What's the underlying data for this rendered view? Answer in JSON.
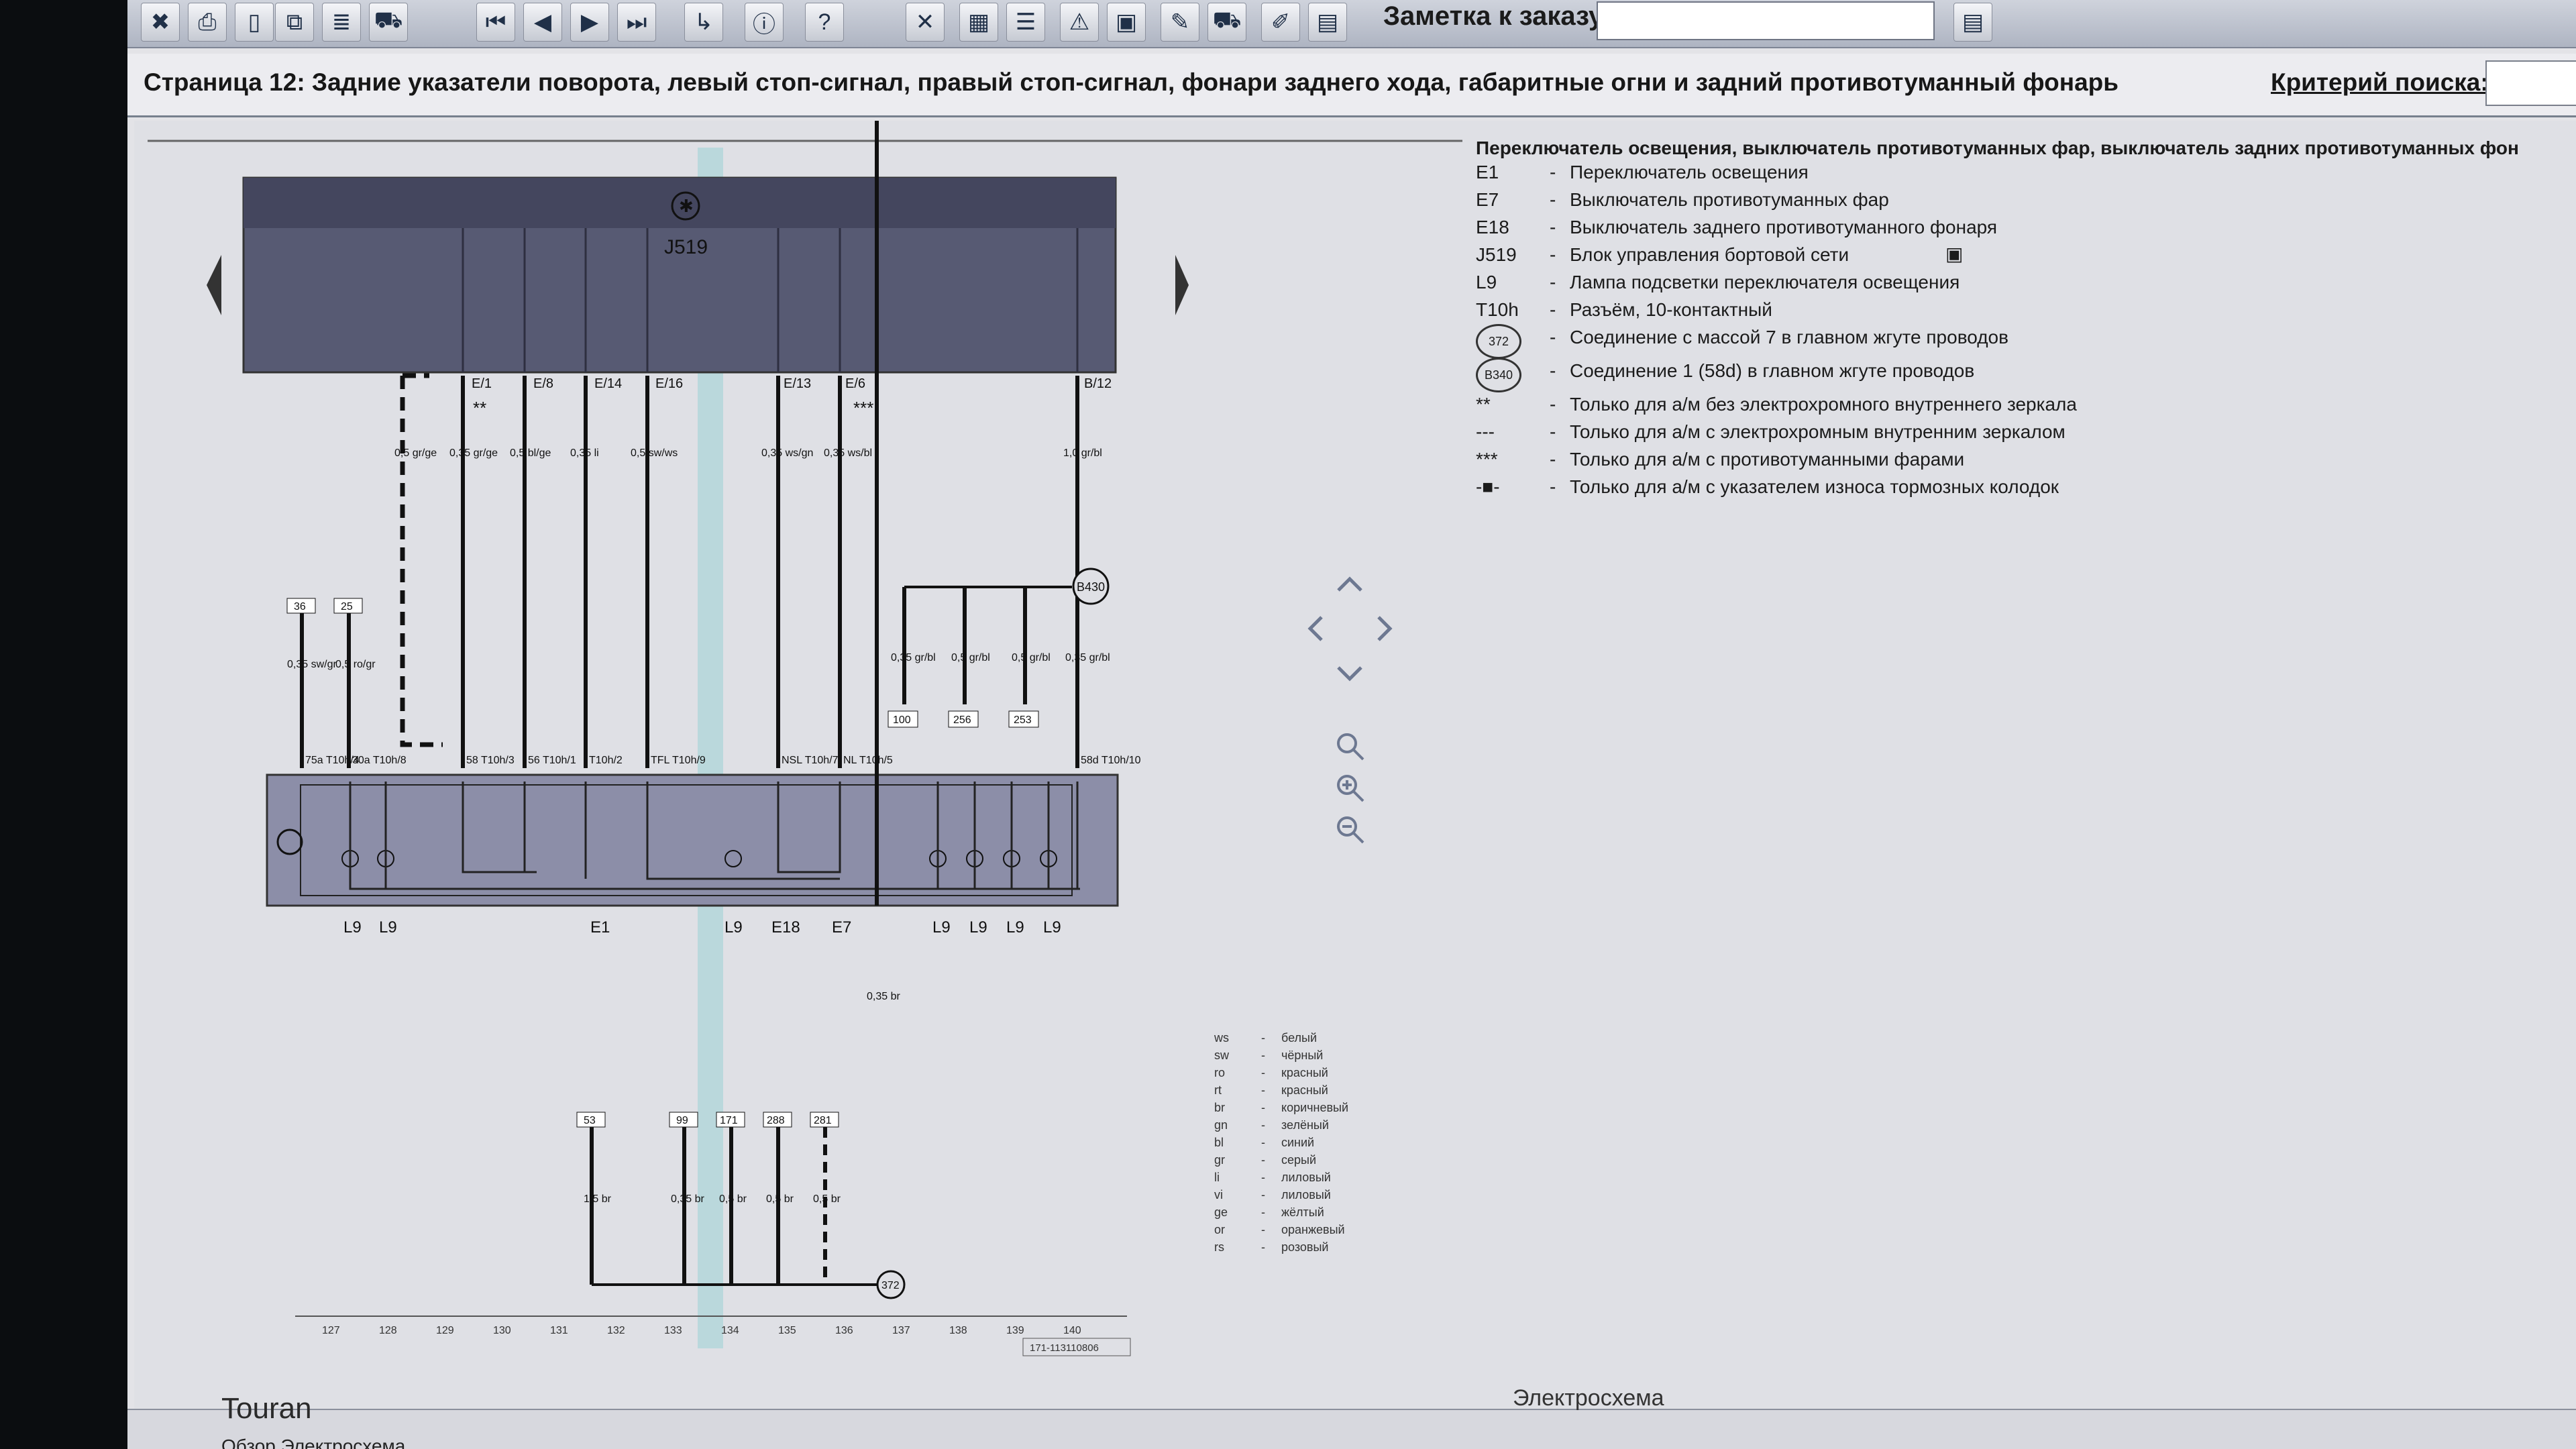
{
  "toolbar": {
    "buttons": [
      "tool-icon",
      "print-icon",
      "document-icon",
      "copy-icon",
      "notes-icon",
      "car-icon",
      "first-icon",
      "prev-icon",
      "next-icon",
      "last-icon",
      "link-icon",
      "info-icon",
      "help-icon",
      "wrench-icon",
      "book-icon",
      "list-icon",
      "warning-icon",
      "save-icon",
      "tools-icon",
      "car2-icon",
      "edit-icon",
      "report-icon"
    ],
    "note_label": "Заметка к заказу:",
    "note_value": ""
  },
  "header": {
    "title": "Страница 12: Задние указатели поворота, левый стоп-сигнал, правый стоп-сигнал, фонари заднего хода, габаритные огни и задний противотуманный фонарь",
    "search_label": "Критерий поиска:",
    "search_value": ""
  },
  "legend": {
    "title": "Переключатель освещения, выключатель противотуманных фар, выключатель задних противотуманных фон",
    "items": [
      {
        "code": "E1",
        "text": "Переключатель освещения"
      },
      {
        "code": "E7",
        "text": "Выключатель противотуманных фар"
      },
      {
        "code": "E18",
        "text": "Выключатель заднего противотуманного фонаря"
      },
      {
        "code": "J519",
        "text": "Блок управления бортовой сети"
      },
      {
        "code": "L9",
        "text": "Лампа подсветки переключателя освещения"
      },
      {
        "code": "T10h",
        "text": "Разъём, 10-контактный"
      },
      {
        "code": "372",
        "text": "Соединение с массой 7 в главном жгуте проводов"
      },
      {
        "code": "B340",
        "text": "Соединение 1 (58d) в главном жгуте проводов"
      },
      {
        "code": "**",
        "text": "Только для а/м без электрохромного внутреннего зеркала"
      },
      {
        "code": "---",
        "text": "Только для а/м с электрохромным внутренним зеркалом"
      },
      {
        "code": "***",
        "text": "Только для а/м с противотуманными фарами"
      },
      {
        "code": "-■-",
        "text": "Только для а/м с указателем износа тормозных колодок"
      }
    ]
  },
  "diagram": {
    "unit_label": "J519",
    "pins_top": [
      "E/1",
      "E/8",
      "E/14",
      "E/16",
      "E/13",
      "E/6",
      "B/12"
    ],
    "wire_specs": [
      "0,5 gr/ge",
      "0,35 gr/ge",
      "0,5 bl/ge",
      "0,35 li",
      "0,5 sw/ws",
      "0,35 ws/gn",
      "0,35 ws/bl",
      "1,0 gr/bl"
    ],
    "connector_labels": [
      "75a T10h/4",
      "30a T10h/8",
      "58 T10h/3",
      "56 T10h/1",
      "T10h/2",
      "TFL T10h/9",
      "NSL T10h/7",
      "NL T10h/5",
      "58d T10h/10"
    ],
    "branch_specs": [
      "0,35 gr/bl",
      "0,5 gr/bl",
      "0,5 gr/bl",
      "0,35 gr/bl"
    ],
    "branch_refs": [
      "100",
      "256",
      "253"
    ],
    "left_specs": [
      "0,35 sw/gr",
      "0,5 ro/gr"
    ],
    "left_refs": [
      "36",
      "25"
    ],
    "component_labels": [
      "L9",
      "L9",
      "E1",
      "L9",
      "E18",
      "E7",
      "L9",
      "L9",
      "L9",
      "L9"
    ],
    "junction": "B430",
    "bottom_refs": [
      "53",
      "99",
      "171",
      "288",
      "281"
    ],
    "bottom_specs": [
      "1,5 br",
      "0,35 br",
      "0,5 br",
      "0,5 br",
      "0,5 br"
    ],
    "ground_spec": "0,35 br",
    "ground": "372",
    "grid_numbers": [
      "127",
      "128",
      "129",
      "130",
      "131",
      "132",
      "133",
      "134",
      "135",
      "136",
      "137",
      "138",
      "139",
      "140"
    ],
    "doc_code": "171-113110806"
  },
  "color_codes": [
    {
      "code": "ws",
      "name": "белый"
    },
    {
      "code": "sw",
      "name": "чёрный"
    },
    {
      "code": "ro",
      "name": "красный"
    },
    {
      "code": "rt",
      "name": "красный"
    },
    {
      "code": "br",
      "name": "коричневый"
    },
    {
      "code": "gn",
      "name": "зелёный"
    },
    {
      "code": "bl",
      "name": "синий"
    },
    {
      "code": "gr",
      "name": "серый"
    },
    {
      "code": "li",
      "name": "лиловый"
    },
    {
      "code": "vi",
      "name": "лиловый"
    },
    {
      "code": "ge",
      "name": "жёлтый"
    },
    {
      "code": "or",
      "name": "оранжевый"
    },
    {
      "code": "rs",
      "name": "розовый"
    }
  ],
  "status": {
    "model": "Touran",
    "document": "Электросхема",
    "tabs": "Обзор   Электросхема"
  }
}
